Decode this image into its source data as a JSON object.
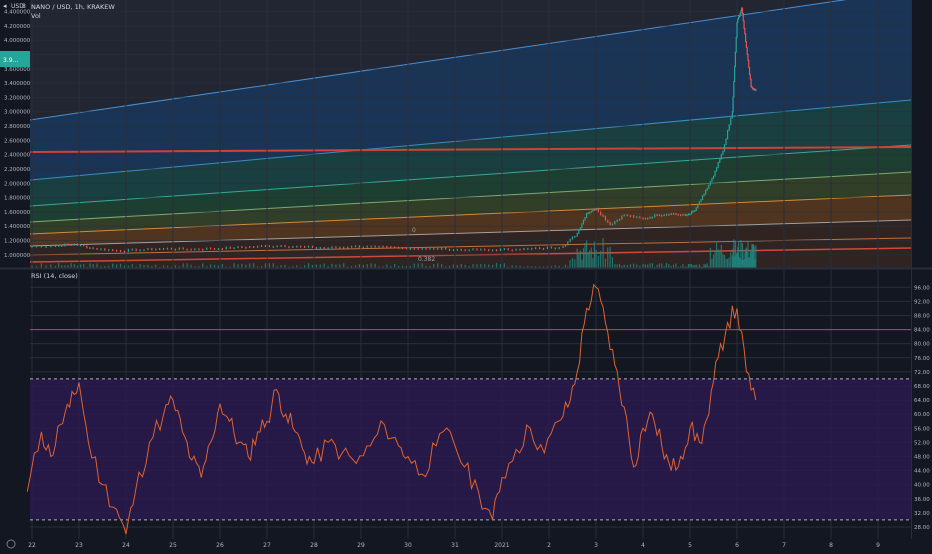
{
  "header": {
    "symbol_title": "NANO / USD, 1h, KRAKEW",
    "indicator_label": "Vol",
    "currency_label": "USD",
    "arrow_glyph": "◂",
    "lock_glyph": "8"
  },
  "colors": {
    "background": "#131722",
    "rsi_line": "#e0622e",
    "rsi_band": "#2a1a4e",
    "level_line": "#d0413b",
    "candle_up": "#26a69a",
    "candle_down": "#ef5350",
    "volume": "#1f8a82",
    "price_tag_bg": "#26a69a"
  },
  "chart_data": [
    {
      "type": "line",
      "title": "NANO / USD, 1h, KRAKEW",
      "x_ticks": [
        "22",
        "23",
        "24",
        "25",
        "26",
        "27",
        "28",
        "29",
        "30",
        "31",
        "2021",
        "2",
        "3",
        "4",
        "5",
        "6",
        "7",
        "8",
        "9"
      ],
      "y_ticks": [
        "1.000000",
        "1.200000",
        "1.400000",
        "1.600000",
        "1.800000",
        "2.000000",
        "2.200000",
        "2.400000",
        "2.600000",
        "2.800000",
        "3.000000",
        "3.200000",
        "3.400000",
        "3.600000",
        "3.800000",
        "4.000000",
        "4.200000",
        "4.400000"
      ],
      "ylim": [
        0.9,
        4.45
      ],
      "close_price_label": "",
      "price_label_sub": "",
      "price_tag_text": "3.9…",
      "fib_label": "0.382",
      "fib_label_2": "0",
      "points": [
        {
          "x": 21.9,
          "y": 1.12
        },
        {
          "x": 22.5,
          "y": 1.13
        },
        {
          "x": 22.9,
          "y": 1.15
        },
        {
          "x": 23.3,
          "y": 1.09
        },
        {
          "x": 23.8,
          "y": 1.06
        },
        {
          "x": 24.3,
          "y": 1.07
        },
        {
          "x": 24.8,
          "y": 1.09
        },
        {
          "x": 25.3,
          "y": 1.08
        },
        {
          "x": 25.8,
          "y": 1.09
        },
        {
          "x": 26.3,
          "y": 1.1
        },
        {
          "x": 26.8,
          "y": 1.12
        },
        {
          "x": 27.3,
          "y": 1.13
        },
        {
          "x": 27.8,
          "y": 1.11
        },
        {
          "x": 28.3,
          "y": 1.1
        },
        {
          "x": 28.8,
          "y": 1.12
        },
        {
          "x": 29.3,
          "y": 1.11
        },
        {
          "x": 29.8,
          "y": 1.1
        },
        {
          "x": 30.3,
          "y": 1.09
        },
        {
          "x": 30.8,
          "y": 1.08
        },
        {
          "x": 31.3,
          "y": 1.07
        },
        {
          "x": 31.8,
          "y": 1.07
        },
        {
          "x": 32.3,
          "y": 1.08
        },
        {
          "x": 32.8,
          "y": 1.09
        },
        {
          "x": 33.3,
          "y": 1.12
        },
        {
          "x": 33.6,
          "y": 1.3
        },
        {
          "x": 33.8,
          "y": 1.58
        },
        {
          "x": 34.0,
          "y": 1.65
        },
        {
          "x": 34.3,
          "y": 1.42
        },
        {
          "x": 34.6,
          "y": 1.56
        },
        {
          "x": 35.0,
          "y": 1.5
        },
        {
          "x": 35.3,
          "y": 1.56
        },
        {
          "x": 35.6,
          "y": 1.58
        },
        {
          "x": 35.9,
          "y": 1.55
        },
        {
          "x": 36.1,
          "y": 1.62
        },
        {
          "x": 36.3,
          "y": 1.85
        },
        {
          "x": 36.5,
          "y": 2.1
        },
        {
          "x": 36.7,
          "y": 2.45
        },
        {
          "x": 36.9,
          "y": 3.0
        },
        {
          "x": 37.0,
          "y": 4.25
        },
        {
          "x": 37.1,
          "y": 4.45
        },
        {
          "x": 37.2,
          "y": 3.9
        },
        {
          "x": 37.3,
          "y": 3.35
        },
        {
          "x": 37.4,
          "y": 3.3
        }
      ]
    },
    {
      "type": "line",
      "title": "RSI (14, close)",
      "x_ticks": [
        "22",
        "23",
        "24",
        "25",
        "26",
        "27",
        "28",
        "29",
        "30",
        "31",
        "2021",
        "2",
        "3",
        "4",
        "5",
        "6",
        "7",
        "8",
        "9"
      ],
      "y_ticks": [
        "28.00",
        "32.00",
        "36.00",
        "40.00",
        "44.00",
        "48.00",
        "52.00",
        "56.00",
        "60.00",
        "64.00",
        "68.00",
        "72.00",
        "76.00",
        "80.00",
        "84.00",
        "88.00",
        "92.00",
        "96.00"
      ],
      "ylim": [
        26,
        97.5
      ],
      "upper_band": 70,
      "lower_band": 30,
      "upper_line": 84,
      "rsi_label_right": "68.25",
      "points": [
        {
          "x": 21.9,
          "y": 38
        },
        {
          "x": 22.2,
          "y": 55
        },
        {
          "x": 22.4,
          "y": 48
        },
        {
          "x": 22.6,
          "y": 57
        },
        {
          "x": 22.8,
          "y": 62
        },
        {
          "x": 23.0,
          "y": 69
        },
        {
          "x": 23.2,
          "y": 52
        },
        {
          "x": 23.5,
          "y": 40
        },
        {
          "x": 23.8,
          "y": 33
        },
        {
          "x": 24.0,
          "y": 26
        },
        {
          "x": 24.2,
          "y": 38
        },
        {
          "x": 24.5,
          "y": 52
        },
        {
          "x": 24.8,
          "y": 60
        },
        {
          "x": 25.0,
          "y": 64
        },
        {
          "x": 25.2,
          "y": 55
        },
        {
          "x": 25.4,
          "y": 47
        },
        {
          "x": 25.6,
          "y": 42
        },
        {
          "x": 25.8,
          "y": 52
        },
        {
          "x": 26.0,
          "y": 63
        },
        {
          "x": 26.2,
          "y": 58
        },
        {
          "x": 26.4,
          "y": 52
        },
        {
          "x": 26.6,
          "y": 48
        },
        {
          "x": 26.8,
          "y": 55
        },
        {
          "x": 27.0,
          "y": 58
        },
        {
          "x": 27.2,
          "y": 67
        },
        {
          "x": 27.4,
          "y": 60
        },
        {
          "x": 27.6,
          "y": 55
        },
        {
          "x": 27.8,
          "y": 49
        },
        {
          "x": 28.0,
          "y": 46
        },
        {
          "x": 28.3,
          "y": 52
        },
        {
          "x": 28.6,
          "y": 49
        },
        {
          "x": 28.9,
          "y": 46
        },
        {
          "x": 29.2,
          "y": 51
        },
        {
          "x": 29.5,
          "y": 57
        },
        {
          "x": 29.8,
          "y": 51
        },
        {
          "x": 30.0,
          "y": 48
        },
        {
          "x": 30.3,
          "y": 43
        },
        {
          "x": 30.6,
          "y": 51
        },
        {
          "x": 30.9,
          "y": 55
        },
        {
          "x": 31.2,
          "y": 45
        },
        {
          "x": 31.5,
          "y": 38
        },
        {
          "x": 31.8,
          "y": 30
        },
        {
          "x": 32.0,
          "y": 42
        },
        {
          "x": 32.3,
          "y": 50
        },
        {
          "x": 32.6,
          "y": 56
        },
        {
          "x": 32.9,
          "y": 49
        },
        {
          "x": 33.2,
          "y": 58
        },
        {
          "x": 33.4,
          "y": 62
        },
        {
          "x": 33.6,
          "y": 72
        },
        {
          "x": 33.8,
          "y": 90
        },
        {
          "x": 34.0,
          "y": 96
        },
        {
          "x": 34.2,
          "y": 86
        },
        {
          "x": 34.4,
          "y": 74
        },
        {
          "x": 34.6,
          "y": 62
        },
        {
          "x": 34.8,
          "y": 45
        },
        {
          "x": 35.0,
          "y": 56
        },
        {
          "x": 35.2,
          "y": 60
        },
        {
          "x": 35.4,
          "y": 51
        },
        {
          "x": 35.6,
          "y": 44
        },
        {
          "x": 35.8,
          "y": 48
        },
        {
          "x": 36.0,
          "y": 56
        },
        {
          "x": 36.2,
          "y": 52
        },
        {
          "x": 36.4,
          "y": 60
        },
        {
          "x": 36.6,
          "y": 76
        },
        {
          "x": 36.8,
          "y": 86
        },
        {
          "x": 37.0,
          "y": 90
        },
        {
          "x": 37.2,
          "y": 72
        },
        {
          "x": 37.4,
          "y": 64
        }
      ]
    }
  ]
}
